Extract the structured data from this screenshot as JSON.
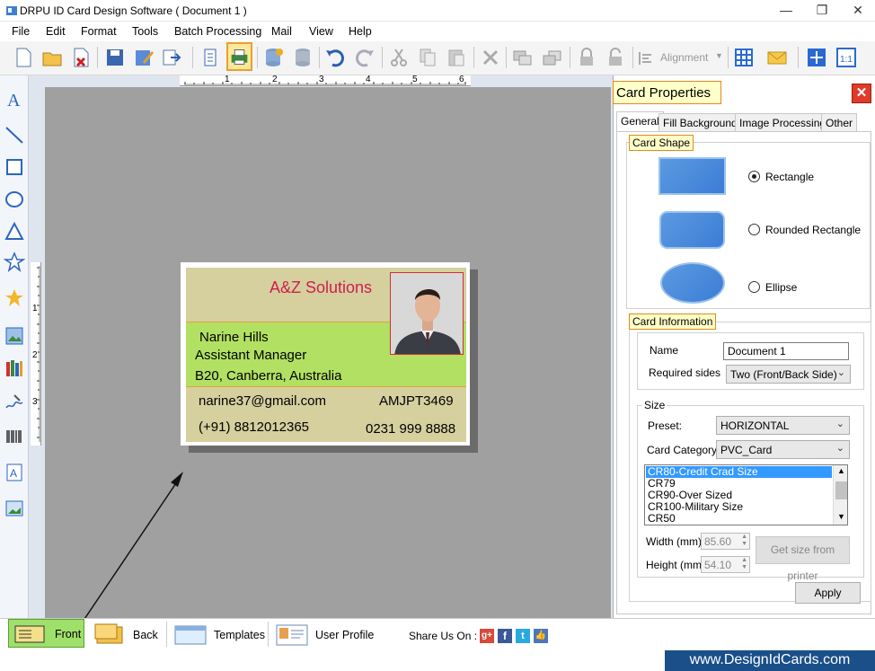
{
  "window": {
    "title": "DRPU ID Card Design Software ( Document 1 )",
    "minimize": "—",
    "restore": "❐",
    "close": "✕"
  },
  "menu": [
    "File",
    "Edit",
    "Format",
    "Tools",
    "Batch Processing",
    "Mail",
    "View",
    "Help"
  ],
  "toolbar": {
    "alignment_label": "Alignment"
  },
  "ruler": {
    "h_ticks": [
      "1",
      "2",
      "3",
      "4",
      "5",
      "6"
    ],
    "v_ticks": [
      "1",
      "2",
      "3"
    ]
  },
  "card": {
    "company": "A&Z Solutions",
    "name": "Narine  Hills",
    "title": "Assistant Manager",
    "address": "B20, Canberra, Australia",
    "email": "narine37@gmail.com",
    "id": "AMJPT3469",
    "phone1": "(+91) 8812012365",
    "phone2": "0231 999 8888"
  },
  "panel": {
    "header": "Card Properties",
    "tabs": [
      "General",
      "Fill Background",
      "Image Processing",
      "Other"
    ],
    "card_shape_label": "Card Shape",
    "shapes": [
      {
        "label": "Rectangle",
        "selected": true
      },
      {
        "label": "Rounded Rectangle",
        "selected": false
      },
      {
        "label": "Ellipse",
        "selected": false
      }
    ],
    "card_info_label": "Card Information",
    "name_label": "Name",
    "name_value": "Document 1",
    "sides_label": "Required sides",
    "sides_value": "Two (Front/Back Side)",
    "size_label": "Size",
    "preset_label": "Preset:",
    "preset_value": "HORIZONTAL",
    "category_label": "Card Category",
    "category_value": "PVC_Card",
    "size_list": [
      "CR80-Credit Crad Size",
      "CR79",
      "CR90-Over Sized",
      "CR100-Military Size",
      "CR50"
    ],
    "width_label": "Width  (mm)",
    "width_value": "85.60",
    "height_label": "Height  (mm)",
    "height_value": "54.10",
    "printer_button": "Get size from printer",
    "apply_button": "Apply"
  },
  "bottom": {
    "front": "Front",
    "back": "Back",
    "templates": "Templates",
    "user_profile": "User Profile",
    "share": "Share Us On :"
  },
  "footer": "www.DesignIdCards.com"
}
